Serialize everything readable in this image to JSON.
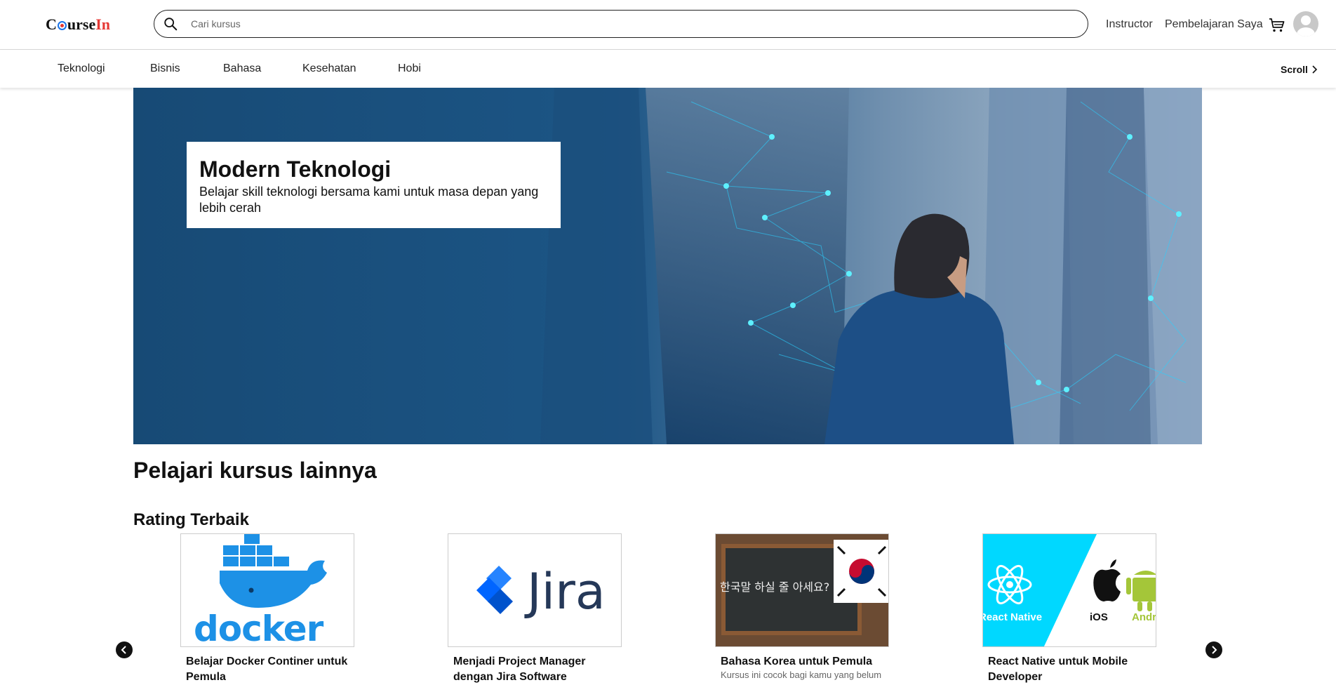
{
  "header": {
    "logo_prefix": "C",
    "logo_mid": "urse",
    "logo_suffix": "In",
    "search_placeholder": "Cari kursus",
    "nav": [
      "Instructor",
      "Pembelajaran Saya"
    ]
  },
  "categories": [
    "Teknologi",
    "Bisnis",
    "Bahasa",
    "Kesehatan",
    "Hobi"
  ],
  "scroll_label": "Scroll",
  "hero": {
    "title": "Modern Teknologi",
    "subtitle": "Belajar skill teknologi bersama kami untuk masa depan yang lebih cerah"
  },
  "section_title": "Pelajari kursus lainnya",
  "section_subtitle": "Rating Terbaik",
  "courses": [
    {
      "title": "Belajar Docker Continer untuk Pemula",
      "thumb_text": "docker",
      "desc": ""
    },
    {
      "title": "Menjadi Project Manager dengan Jira Software",
      "thumb_text": "Jira",
      "desc": ""
    },
    {
      "title": "Bahasa Korea untuk Pemula",
      "thumb_text": "한국말 하실 줄 아세요?",
      "desc": "Kursus ini cocok bagi kamu yang belum"
    },
    {
      "title": "React Native untuk Mobile Developer",
      "thumb_text": "React Native",
      "thumb_text2": "iOS",
      "thumb_text3": "Android",
      "desc": ""
    }
  ],
  "colors": {
    "hero_bg": "#17456f",
    "docker_blue": "#1d91e6",
    "jira_blue": "#2684ff",
    "react_cyan": "#00d8ff",
    "android_green": "#a4c639",
    "logo_red": "#e53935"
  },
  "icons": [
    "search-icon",
    "cart-icon",
    "avatar-icon",
    "chevron-right-icon",
    "chevron-left-icon"
  ]
}
